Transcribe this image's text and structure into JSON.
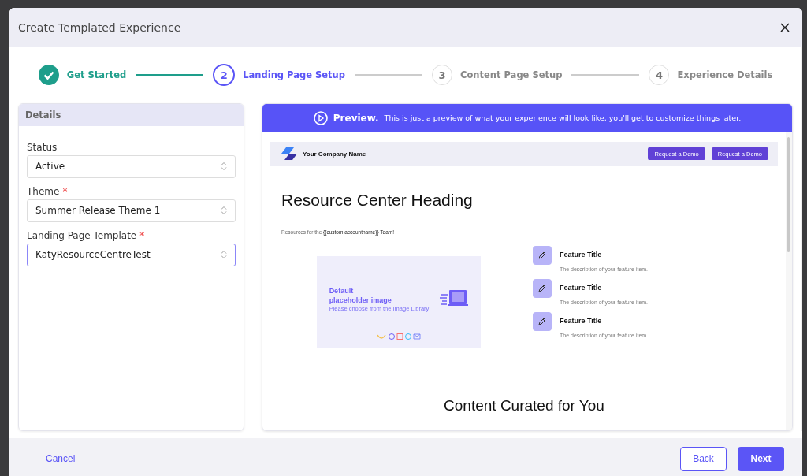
{
  "dialog": {
    "title": "Create Templated Experience"
  },
  "steps": [
    {
      "label": "Get Started",
      "done": true,
      "selected": false
    },
    {
      "number": "2",
      "label": "Landing Page Setup",
      "done": false,
      "selected": true
    },
    {
      "number": "3",
      "label": "Content Page Setup",
      "done": false,
      "selected": false
    },
    {
      "number": "4",
      "label": "Experience Details",
      "done": false,
      "selected": false
    }
  ],
  "details": {
    "title": "Details",
    "fields": [
      {
        "label": "Status",
        "value": "Active",
        "focused": false
      },
      {
        "label": "Theme",
        "required_mark": "*",
        "value": "Summer Release Theme 1",
        "focused": false
      },
      {
        "label": "Landing Page Template",
        "required_mark": "*",
        "value": "KatyResourceCentreTest",
        "focused": true
      }
    ]
  },
  "preview": {
    "banner_title": "Preview.",
    "banner_text": "This is just a preview of what your experience will look like, you'll get to customize things later.",
    "page": {
      "company_name": "Your Company Name",
      "buttons": [
        "Request a Demo",
        "Request a Demo"
      ],
      "heading": "Resource Center Heading",
      "subtitle": "Resources for the **{{custom.accountname}} Team!**",
      "image": {
        "title": "Default placeholder image",
        "caption": "Please choose from the Image Library"
      },
      "features": [
        {
          "title": "Feature Title",
          "description": "The description of your feature item."
        },
        {
          "title": "Feature Title",
          "description": "The description of your feature item."
        },
        {
          "title": "Feature Title",
          "description": "The description of your feature item."
        }
      ],
      "section_heading": "Content Curated for You"
    }
  },
  "footer": {
    "cancel": "Cancel",
    "back": "Back",
    "next": "Next"
  }
}
